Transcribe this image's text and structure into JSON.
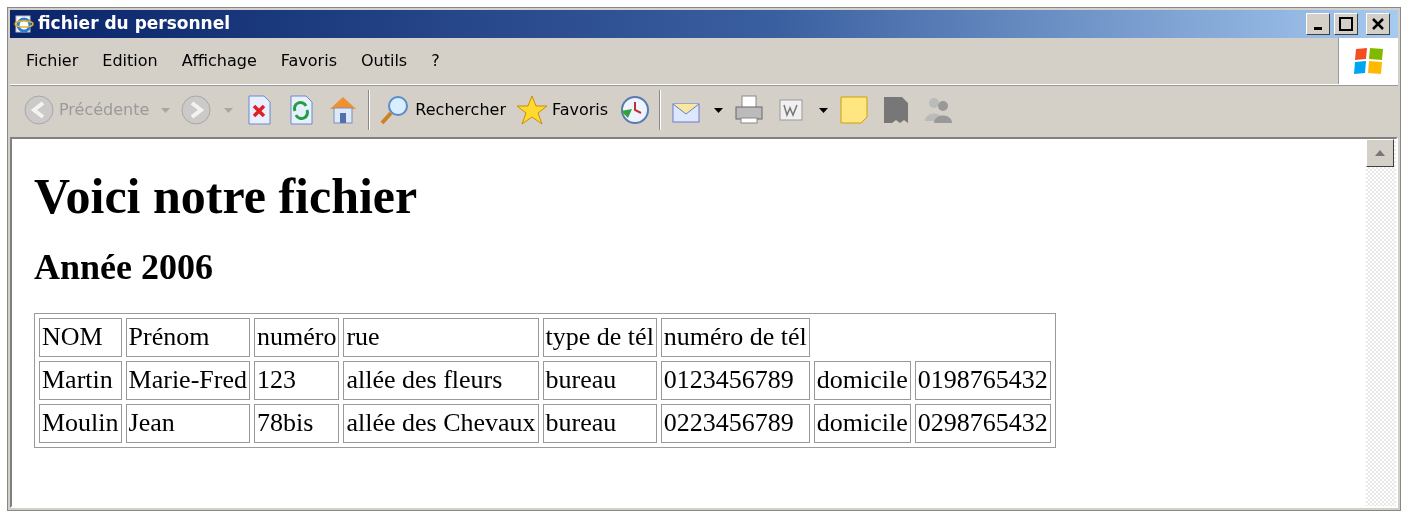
{
  "window": {
    "title": "fichier du personnel"
  },
  "menu": [
    "Fichier",
    "Edition",
    "Affichage",
    "Favoris",
    "Outils",
    "?"
  ],
  "toolbar": [
    {
      "kind": "button",
      "label": "Précédente",
      "disabled": true,
      "dropdown": true
    },
    {
      "kind": "button",
      "disabled": true,
      "dropdown": true
    },
    {
      "kind": "button",
      "disabled": false,
      "dropdown": false
    },
    {
      "kind": "button",
      "disabled": false,
      "dropdown": false
    },
    {
      "kind": "button",
      "disabled": false,
      "dropdown": false
    },
    {
      "kind": "separator"
    },
    {
      "kind": "button",
      "label": "Rechercher",
      "disabled": false,
      "dropdown": false
    },
    {
      "kind": "button",
      "label": "Favoris",
      "disabled": false,
      "dropdown": false
    },
    {
      "kind": "button",
      "disabled": false,
      "dropdown": false
    },
    {
      "kind": "separator"
    },
    {
      "kind": "button",
      "disabled": false,
      "dropdown": true
    },
    {
      "kind": "button",
      "disabled": false,
      "dropdown": false
    },
    {
      "kind": "button",
      "disabled": false,
      "dropdown": true
    },
    {
      "kind": "button",
      "disabled": false,
      "dropdown": false
    },
    {
      "kind": "button",
      "disabled": false,
      "dropdown": false
    },
    {
      "kind": "button",
      "disabled": false,
      "dropdown": false
    }
  ],
  "page": {
    "heading": "Voici notre fichier",
    "subheading": "Année 2006",
    "table": {
      "rows": [
        [
          "NOM",
          "Prénom",
          "numéro",
          "rue",
          "type de tél",
          "numéro de tél"
        ],
        [
          "Martin",
          "Marie-Fred",
          "123",
          "allée des fleurs",
          "bureau",
          "0123456789",
          "domicile",
          "0198765432"
        ],
        [
          "Moulin",
          "Jean",
          "78bis",
          "allée des Chevaux",
          "bureau",
          "0223456789",
          "domicile",
          "0298765432"
        ]
      ]
    }
  }
}
